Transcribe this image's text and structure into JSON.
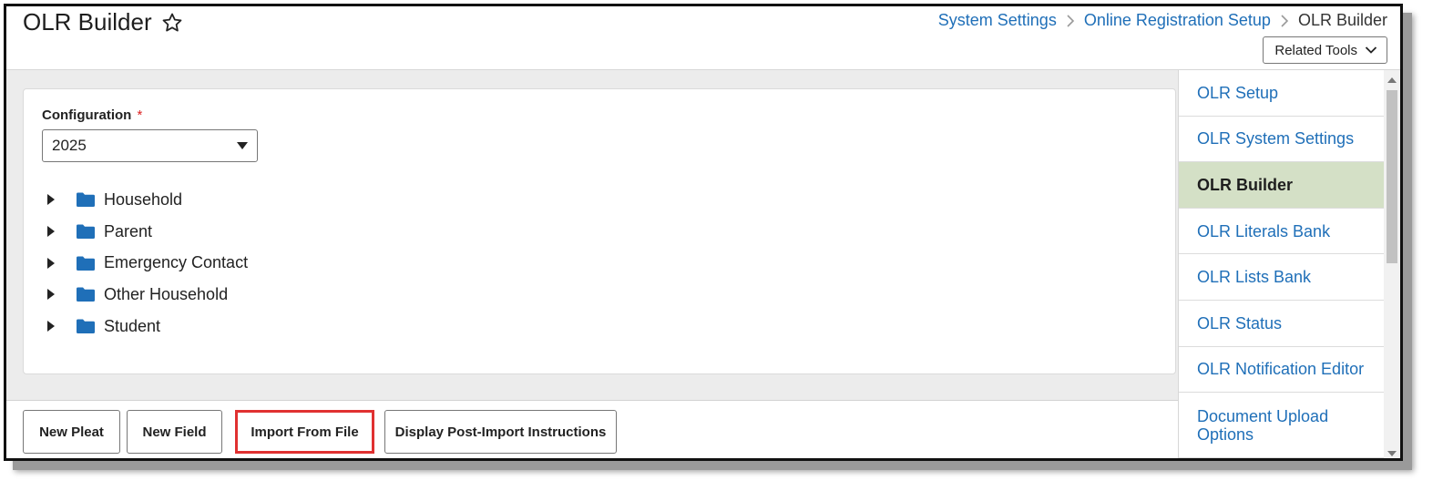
{
  "header": {
    "title": "OLR Builder",
    "breadcrumb": [
      "System Settings",
      "Online Registration Setup",
      "OLR Builder"
    ],
    "related_tools": "Related Tools"
  },
  "main": {
    "configuration": {
      "label": "Configuration",
      "required_mark": "*",
      "value": "2025"
    },
    "tree": [
      {
        "label": "Household",
        "icon": "folder-icon"
      },
      {
        "label": "Parent",
        "icon": "folder-icon"
      },
      {
        "label": "Emergency Contact",
        "icon": "folder-icon"
      },
      {
        "label": "Other Household",
        "icon": "folder-icon"
      },
      {
        "label": "Student",
        "icon": "folder-icon"
      }
    ],
    "actions": [
      "New Pleat",
      "New Field",
      "Import From File",
      "Display Post-Import Instructions"
    ]
  },
  "sidebar": {
    "items": [
      {
        "label": "OLR Setup"
      },
      {
        "label": "OLR System Settings"
      },
      {
        "label": "OLR Builder",
        "active": true
      },
      {
        "label": "OLR Literals Bank"
      },
      {
        "label": "OLR Lists Bank"
      },
      {
        "label": "OLR Status"
      },
      {
        "label": "OLR Notification Editor"
      },
      {
        "label": "Document Upload Options"
      }
    ]
  },
  "colors": {
    "link": "#1f6fb8",
    "active_bg": "#d4e0c6",
    "folder": "#1f6fb8",
    "highlight": "#e03131"
  }
}
